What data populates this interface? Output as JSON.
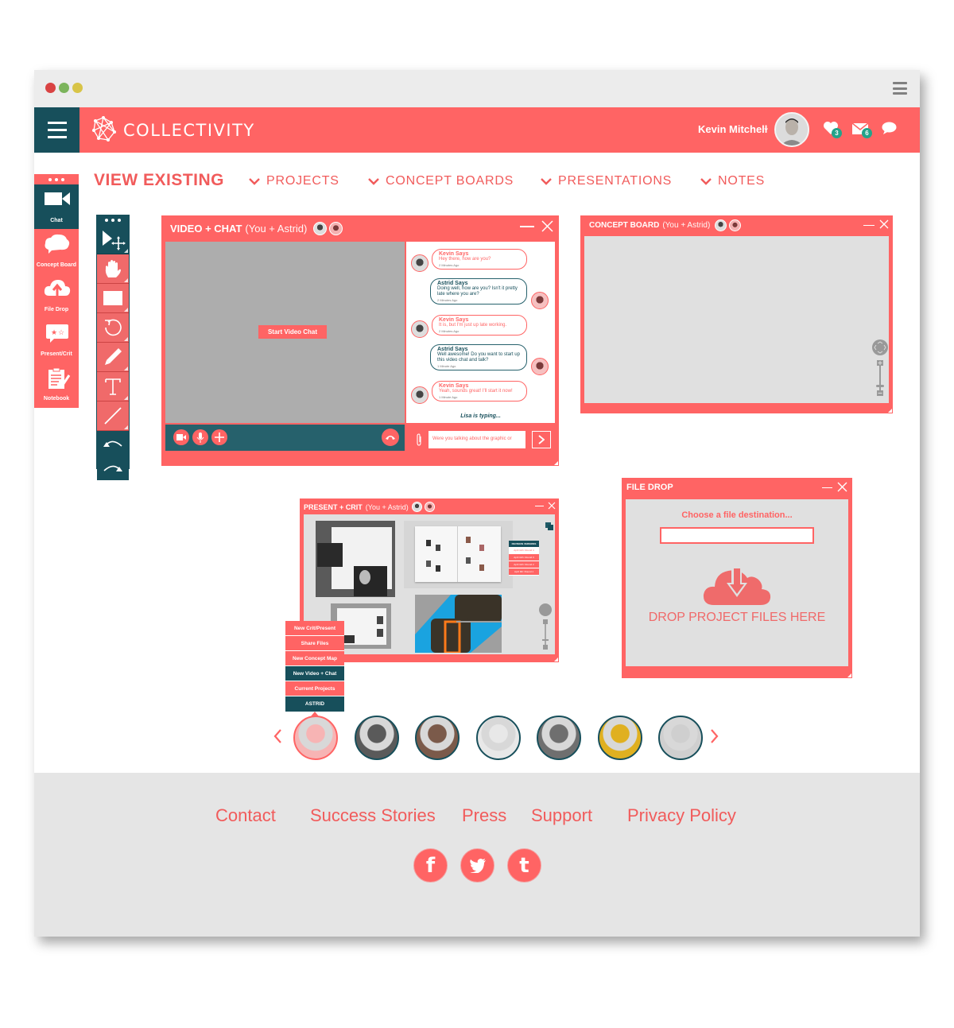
{
  "browser": {
    "traffic_lights": [
      "#d94343",
      "#7cb45c",
      "#d8c447"
    ],
    "menu_icon": "hamburger-icon"
  },
  "header": {
    "brand": "COLLECTIVITY",
    "user_name": "Kevin Mitchell",
    "notifications": {
      "likes": "3",
      "messages": "6"
    }
  },
  "sidebar": {
    "items": [
      {
        "label": "Chat",
        "icon": "video-camera-icon",
        "active": true
      },
      {
        "label": "Concept Board",
        "icon": "cloud-bubble-icon"
      },
      {
        "label": "File Drop",
        "icon": "cloud-upload-icon"
      },
      {
        "label": "Present/Crit",
        "icon": "star-board-icon"
      },
      {
        "label": "Notebook",
        "icon": "notebook-icon"
      }
    ]
  },
  "nav": {
    "title": "VIEW EXISTING",
    "items": [
      "PROJECTS",
      "CONCEPT BOARDS",
      "PRESENTATIONS",
      "NOTES"
    ]
  },
  "tools": [
    "select-move",
    "hand",
    "rectangle",
    "rotate",
    "pencil",
    "text",
    "line",
    "undo",
    "redo"
  ],
  "video_chat": {
    "title": "VIDEO + CHAT",
    "participants": "(You + Astrid)",
    "start_button": "Start Video Chat",
    "messages": [
      {
        "author": "Kevin Says",
        "text": "Hey there, how are you?",
        "time": "2 Minutes Ago",
        "from": "kevin"
      },
      {
        "author": "Astrid Says",
        "text": "Doing well, how are you? Isn't it pretty late where you are?",
        "time": "2 Minutes Ago",
        "from": "astrid"
      },
      {
        "author": "Kevin Says",
        "text": "It is, but I'm just up late working.",
        "time": "2 Minutes Ago",
        "from": "kevin"
      },
      {
        "author": "Astrid Says",
        "text": "Well awesome! Do you want to start up this video chat and talk?",
        "time": "1 Minute Ago",
        "from": "astrid"
      },
      {
        "author": "Kevin Says",
        "text": "Yeah, sounds great! I'll start it now!",
        "time": "1 Minute Ago",
        "from": "kevin"
      }
    ],
    "typing_status": "Lisa is typing...",
    "input_value": "Were you talking about the graphic or"
  },
  "concept_board": {
    "title": "CONCEPT BOARD",
    "participants": "(You + Astrid)"
  },
  "present_crit": {
    "title": "PRESENT + CRIT",
    "participants": "(You + Astrid)",
    "revisions": {
      "header": "REVISION VERSIONS",
      "items": [
        "April 11th: Round 4",
        "April 11th: Round 3",
        "April 11th: Round 2",
        "April 9th: Round 1"
      ]
    }
  },
  "context_menu": {
    "items": [
      "New Crit/Present",
      "Share Files",
      "New Concept Map",
      "New Video + Chat",
      "Current Projects",
      "ASTRID"
    ]
  },
  "file_drop": {
    "title": "FILE DROP",
    "choose_label": "Choose a file destination...",
    "input_value": "",
    "drop_label": "DROP PROJECT FILES HERE"
  },
  "people": {
    "count": 7,
    "selected": 0,
    "colors": [
      "#f7b4b4",
      "#5a5a5a",
      "#7b5a4a",
      "#e8e8e8",
      "#6f6f6f",
      "#e0b020",
      "#cfcfcf"
    ]
  },
  "footer": {
    "links": [
      "Contact",
      "Success Stories",
      "Press",
      "Support",
      "Privacy Policy"
    ],
    "social": [
      {
        "name": "facebook",
        "glyph": "f"
      },
      {
        "name": "twitter",
        "glyph": "🐦"
      },
      {
        "name": "tumblr",
        "glyph": "t"
      }
    ]
  },
  "colors": {
    "brand": "#ff6464",
    "dark": "#174f5b",
    "teal": "#26616c"
  }
}
